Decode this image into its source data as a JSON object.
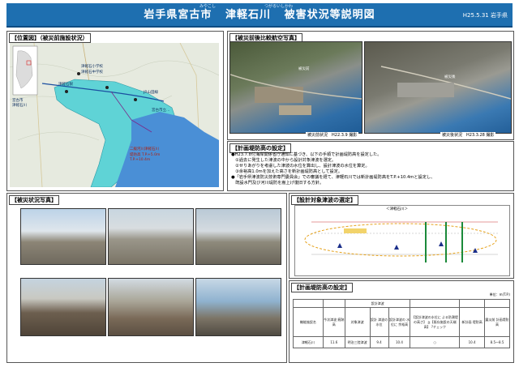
{
  "header": {
    "title_prefix": "岩手県宮古市",
    "title_place": "津軽石川",
    "title_suffix": "被害状況等説明図",
    "ruby_1": "みやこし",
    "ruby_2": "つがるいしかわ",
    "date": "H25.5.31",
    "org": "岩手県"
  },
  "location_panel": {
    "heading": "【位置図】（被災前施設状況）",
    "labels": [
      "津軽石小学校",
      "津軽石中学校",
      "津軽石駅",
      "JR山田線",
      "宮古市立…",
      "二級河川津軽石川",
      "堤防高 T.P.+5.0m",
      "T.P.+10.4m"
    ],
    "inset_labels": [
      "宮古市",
      "津軽石川"
    ]
  },
  "aerial_panel": {
    "heading": "【被災前後比較航空写真】",
    "before_caption": "被災前状況　H22.3.9 撮影",
    "after_caption": "被災後状況　H23.3.28 撮影",
    "before_tag": "被災前",
    "after_tag": "被災後"
  },
  "plan_panel": {
    "heading": "【計画堤防高の設定】",
    "lines": [
      "●H23.7.8付海岸関係省庁通知に基づき、以下の手順で計画堤防高を設定した。",
      "　①過去に発生した津波の中から設計対象津波を選定。",
      "　②せりあがりを考慮した津波の水位を算出し、設計津波の水位を算定。",
      "　③余裕高1.0mを加えた高さを新計画堤防高として設定。",
      "●「岩手県津波防災技術専門委員会」での審議を経て、津軽石川では新計画堤防高をT.P.+10.4mと設定し、",
      "　既設水門及び河川堤防を嵩上げ復旧する方針。"
    ]
  },
  "damage_panel": {
    "heading": "【被災状況写真】"
  },
  "tsunami_panel": {
    "heading": "【設計対象津波の選定】",
    "chart_caption": "＜津軽石川＞"
  },
  "levee_panel": {
    "heading": "【計画堤防高の設定】",
    "unit": "単位：m(T.P.)",
    "header_top": [
      "",
      "",
      "設計津波",
      "",
      "",
      "",
      "",
      ""
    ],
    "header": [
      "機能施設名",
      "今次津波 痕跡高",
      "対象津波",
      "設計 津波の 水位",
      "設計津波の 水位に 余裕高",
      "【設計津波の水位に よる防潮堤の高さ】 ≧【既存施設の天端高】 ?チェック",
      "新計画 堤防高",
      "震災前 計画堤防高"
    ],
    "row": [
      "津軽石川",
      "11.6",
      "明治三陸津波",
      "9.4",
      "10.4",
      "○",
      "10.4",
      "8.5〜8.5"
    ]
  },
  "colors": {
    "title_bar": "#1e6fb0",
    "flood": "#5fd3d6",
    "sea": "#4a8fd6"
  }
}
